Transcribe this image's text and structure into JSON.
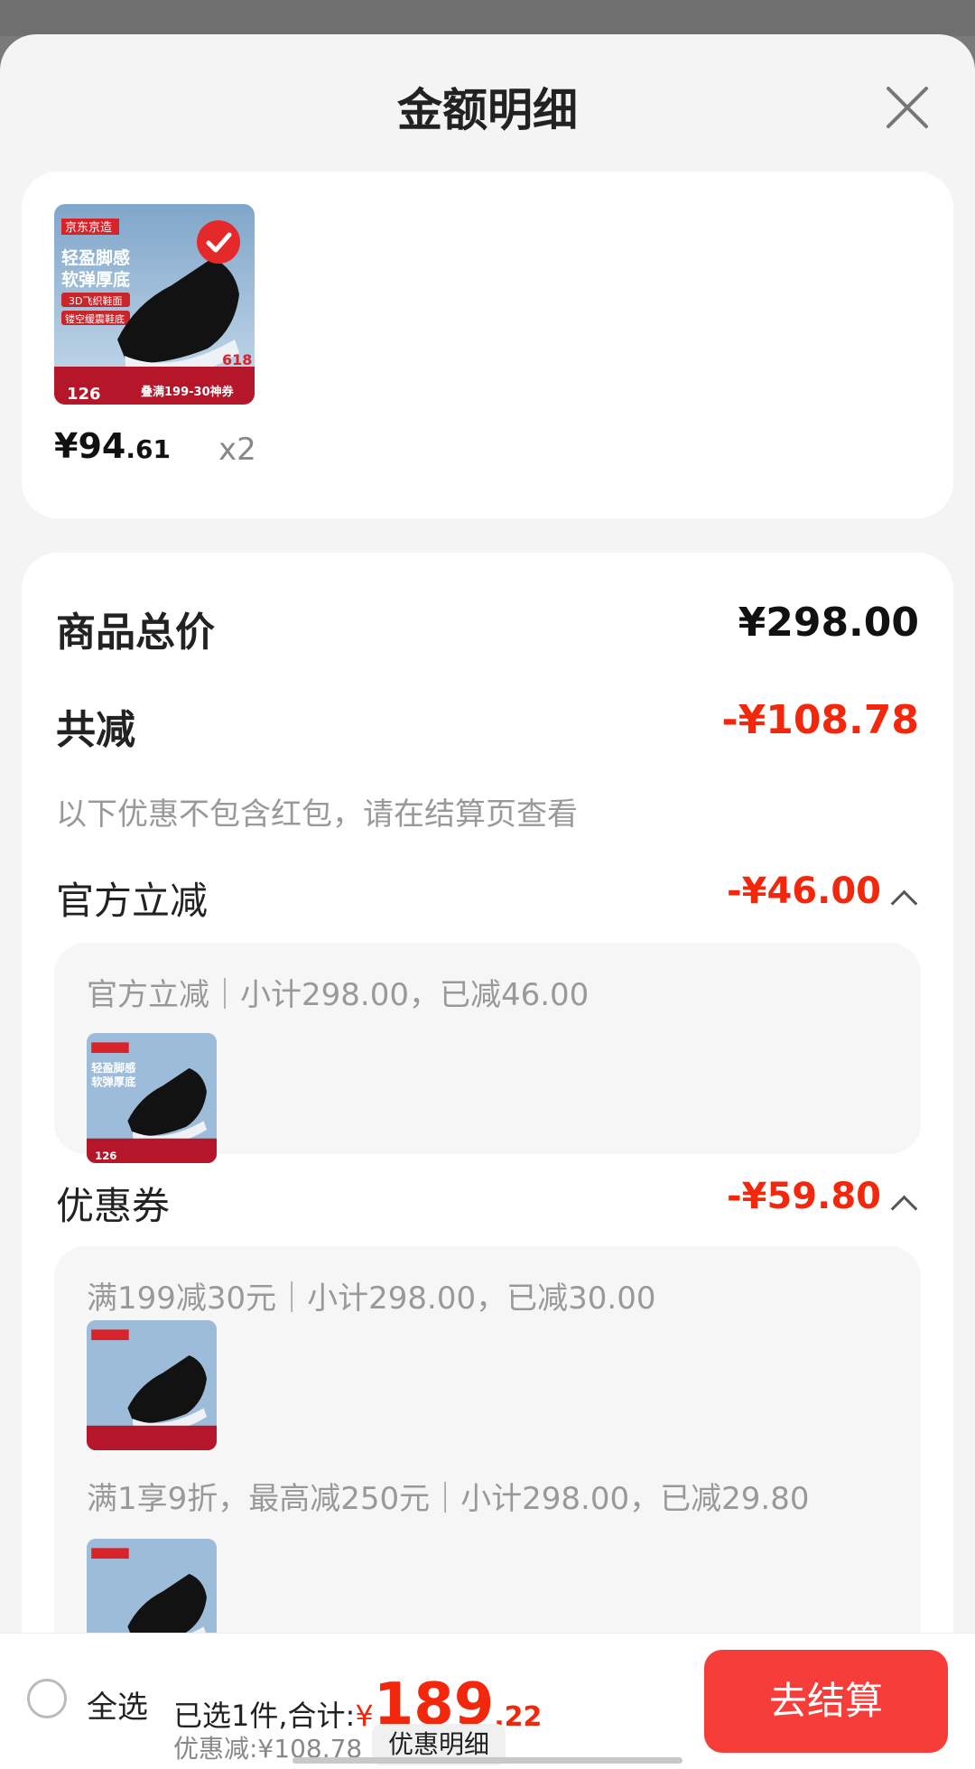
{
  "sheet": {
    "title": "金额明细"
  },
  "product": {
    "thumb": {
      "brand": "京东京造",
      "headline1": "轻盈脚感",
      "headline2": "软弹厚底",
      "tag1": "3D飞织鞋面",
      "tag2": "镂空缓震鞋底",
      "price": "126",
      "promo": "叠满199-30神券",
      "badge": "618"
    },
    "price_int": "¥94",
    "price_dec": ".61",
    "qty": "x2"
  },
  "summary": {
    "total_label": "商品总价",
    "total_value": "¥298.00",
    "reduce_label": "共减",
    "reduce_value": "-¥108.78",
    "note": "以下优惠不包含红包，请在结算页查看"
  },
  "sections": {
    "official": {
      "label": "官方立减",
      "value": "-¥46.00",
      "detail": "官方立减｜小计298.00，已减46.00"
    },
    "coupon": {
      "label": "优惠券",
      "value": "-¥59.80",
      "detail1": "满199减30元｜小计298.00，已减30.00",
      "detail2": "满1享9折，最高减250元｜小计298.00，已减29.80"
    }
  },
  "footer": {
    "select_all": "全选",
    "selected_text": "已选1件,合计:",
    "currency": "¥",
    "total_int": "189",
    "total_dec": ".22",
    "discount_text": "优惠减:¥108.78",
    "detail_button": "优惠明细",
    "checkout_button": "去结算"
  },
  "colors": {
    "accent_red": "#f2270c",
    "button_red": "#f73d3a"
  }
}
